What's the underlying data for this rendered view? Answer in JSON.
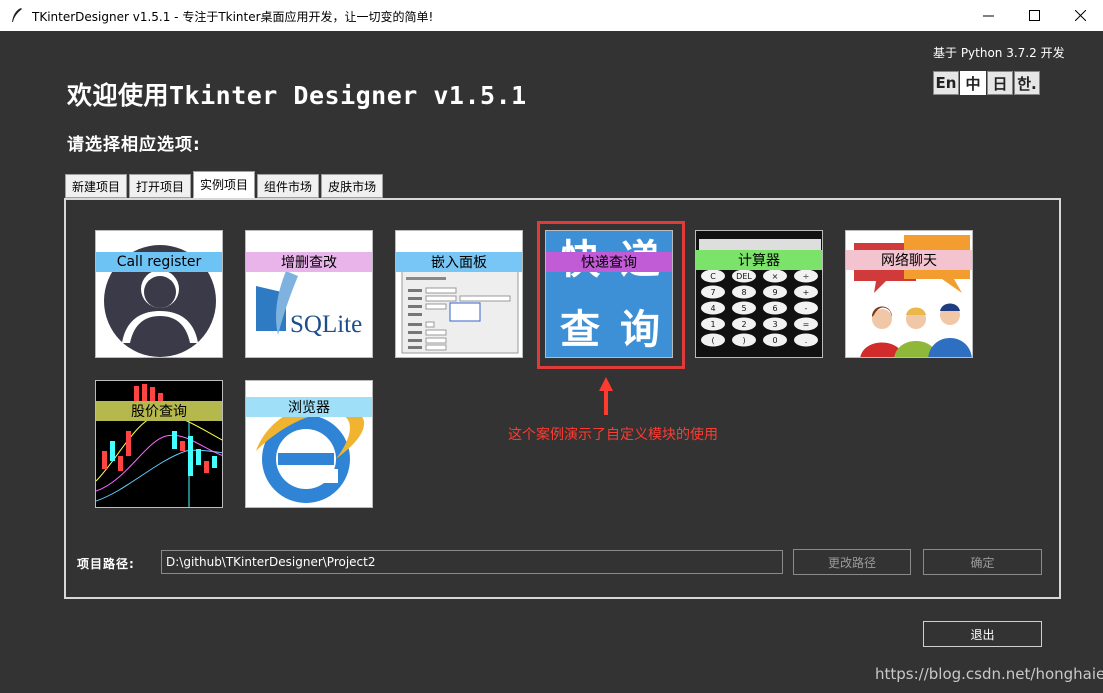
{
  "window": {
    "title": "TKinterDesigner v1.5.1 - 专注于Tkinter桌面应用开发，让一切变的简单!",
    "min_icon": "minimize-icon",
    "max_icon": "maximize-icon",
    "close_icon": "close-icon"
  },
  "header": {
    "based_on": "基于 Python 3.7.2 开发",
    "welcome": "欢迎使用Tkinter Designer v1.5.1",
    "subtitle": "请选择相应选项:",
    "languages": [
      "En",
      "中",
      "日",
      "한."
    ],
    "active_language_index": 1
  },
  "tabs": [
    "新建项目",
    "打开项目",
    "实例项目",
    "组件市场",
    "皮肤市场"
  ],
  "active_tab_index": 2,
  "cards": [
    {
      "label": "Call register",
      "band_color": "#6ec3f5",
      "art": "person-silhouette"
    },
    {
      "label": "增删查改",
      "band_color": "#e8b4ea",
      "art": "sqlite-logo",
      "logo_text": "SQLite"
    },
    {
      "label": "嵌入面板",
      "band_color": "#78c6f5",
      "art": "form-screenshot"
    },
    {
      "label": "快递查询",
      "band_color": "#c15bd6",
      "art": "express-query",
      "big_chars": [
        "快",
        "递",
        "查",
        "询"
      ]
    },
    {
      "label": "计算器",
      "band_color": "#7be26a",
      "art": "calculator",
      "calc_keys": [
        "C",
        "DEL",
        "×",
        "÷",
        "7",
        "8",
        "9",
        "+",
        "4",
        "5",
        "6",
        "-",
        "1",
        "2",
        "3",
        "=",
        "(",
        ")",
        "0",
        "."
      ]
    },
    {
      "label": "网络聊天",
      "band_color": "#f3c3cf",
      "art": "people-chat"
    },
    {
      "label": "股价查询",
      "band_color": "#b5b84c",
      "art": "stock-chart"
    },
    {
      "label": "浏览器",
      "band_color": "#9fe0f8",
      "art": "ie-logo"
    }
  ],
  "annotation": {
    "text": "这个案例演示了自定义模块的使用",
    "color": "#ff3b30"
  },
  "footer": {
    "path_label": "项目路径:",
    "path_value": "D:\\github\\TKinterDesigner\\Project2",
    "change_path": "更改路径",
    "confirm": "确定",
    "exit": "退出"
  },
  "watermark": "https://blog.csdn.net/honghaier"
}
